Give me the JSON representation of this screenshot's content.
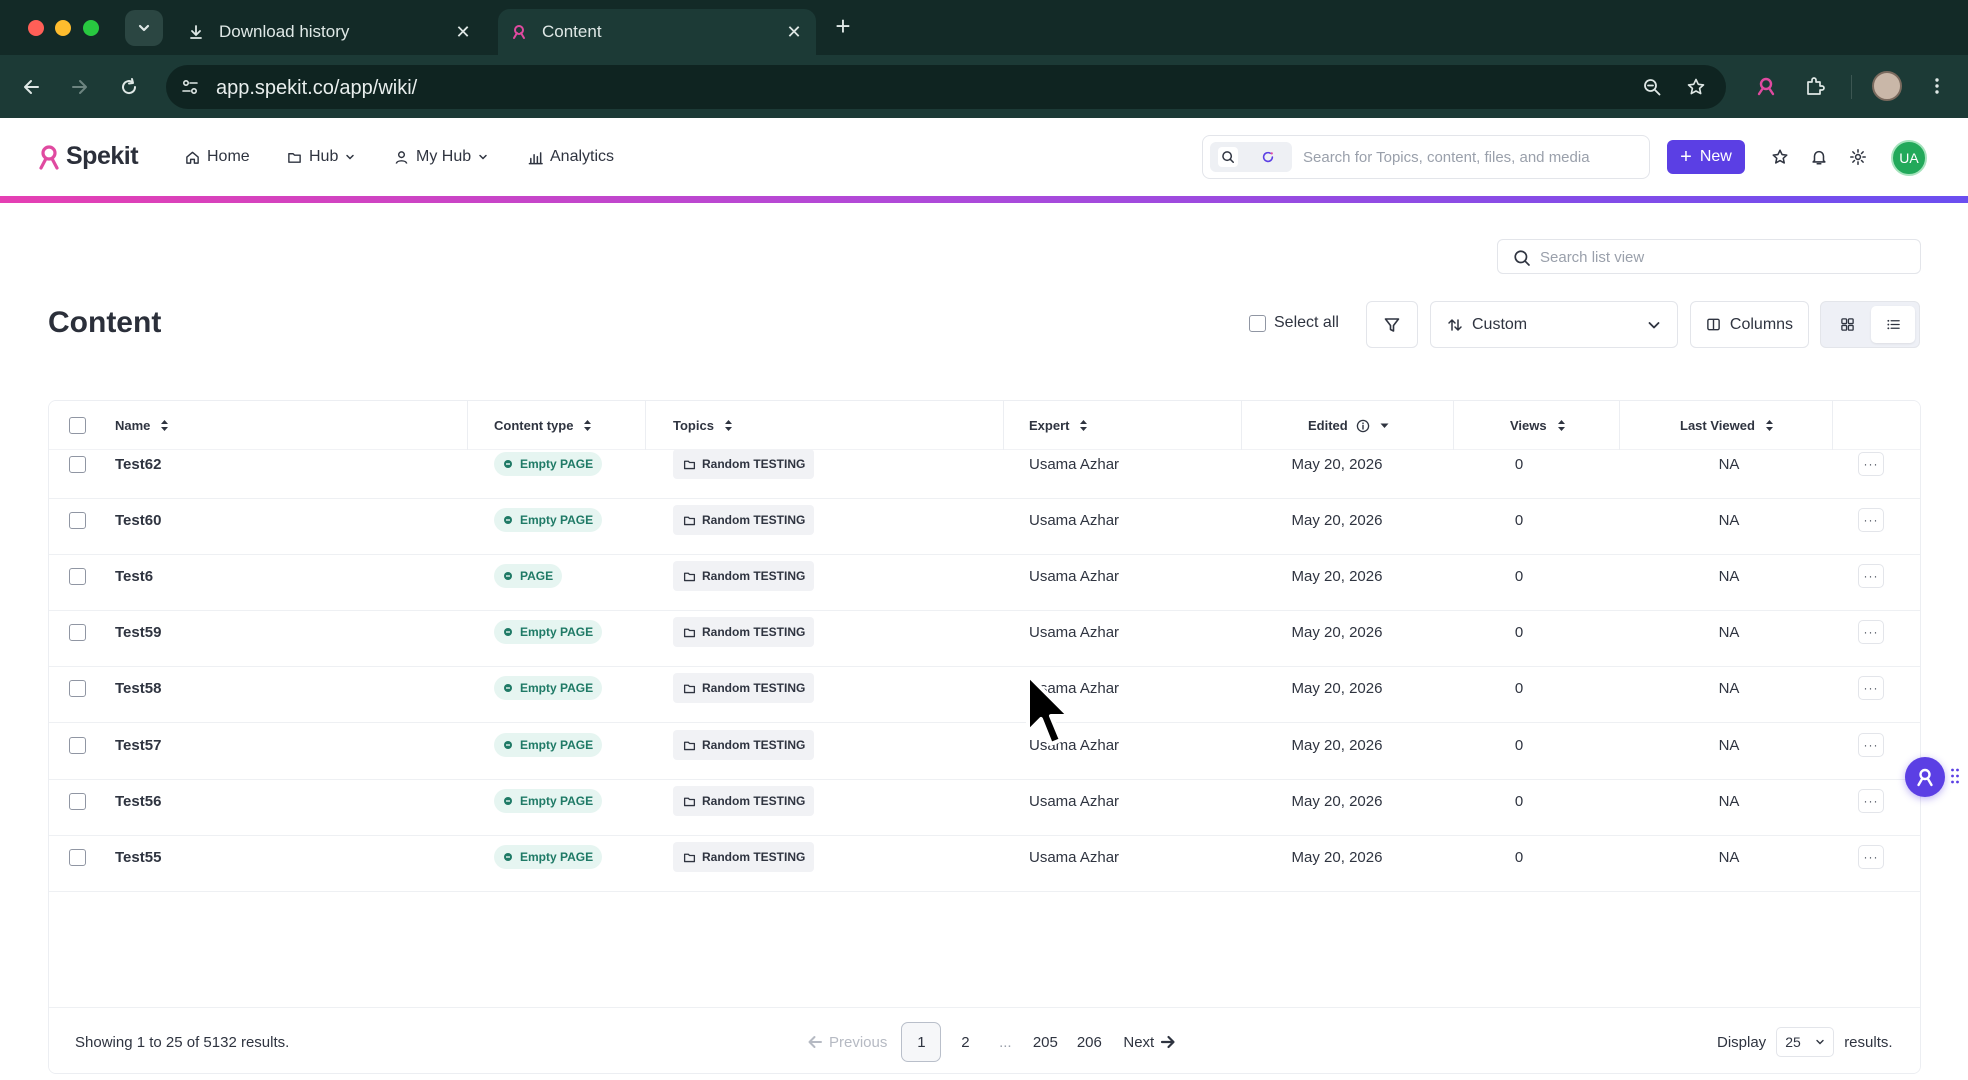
{
  "browser": {
    "tabs": [
      {
        "label": "Download history",
        "icon": "download-icon"
      },
      {
        "label": "Content",
        "icon": "spekit-icon",
        "active": true
      }
    ],
    "url": "app.spekit.co/app/wiki/"
  },
  "app": {
    "brand": "Spekit",
    "nav": [
      {
        "label": "Home",
        "icon": "home-icon"
      },
      {
        "label": "Hub",
        "icon": "folder-icon",
        "dropdown": true
      },
      {
        "label": "My Hub",
        "icon": "user-icon",
        "dropdown": true
      },
      {
        "label": "Analytics",
        "icon": "analytics-icon"
      }
    ],
    "search_placeholder": "Search for Topics, content, files, and media",
    "new_label": "New",
    "user_initials": "UA",
    "accent_color": "#5b3fe4"
  },
  "page": {
    "title": "Content",
    "list_search_placeholder": "Search list view",
    "select_all_label": "Select all",
    "sort_value": "Custom",
    "columns_label": "Columns",
    "view_mode": "list"
  },
  "table": {
    "columns": [
      "Name",
      "Content type",
      "Topics",
      "Expert",
      "Edited",
      "Views",
      "Last Viewed"
    ],
    "rows": [
      {
        "name": "Test62",
        "type": "Empty PAGE",
        "topic": "Random TESTING",
        "expert": "Usama Azhar",
        "edited": "May 20, 2026",
        "views": "0",
        "last_viewed": "NA"
      },
      {
        "name": "Test60",
        "type": "Empty PAGE",
        "topic": "Random TESTING",
        "expert": "Usama Azhar",
        "edited": "May 20, 2026",
        "views": "0",
        "last_viewed": "NA"
      },
      {
        "name": "Test6",
        "type": "PAGE",
        "topic": "Random TESTING",
        "expert": "Usama Azhar",
        "edited": "May 20, 2026",
        "views": "0",
        "last_viewed": "NA"
      },
      {
        "name": "Test59",
        "type": "Empty PAGE",
        "topic": "Random TESTING",
        "expert": "Usama Azhar",
        "edited": "May 20, 2026",
        "views": "0",
        "last_viewed": "NA"
      },
      {
        "name": "Test58",
        "type": "Empty PAGE",
        "topic": "Random TESTING",
        "expert": "Usama Azhar",
        "edited": "May 20, 2026",
        "views": "0",
        "last_viewed": "NA"
      },
      {
        "name": "Test57",
        "type": "Empty PAGE",
        "topic": "Random TESTING",
        "expert": "Usama Azhar",
        "edited": "May 20, 2026",
        "views": "0",
        "last_viewed": "NA"
      },
      {
        "name": "Test56",
        "type": "Empty PAGE",
        "topic": "Random TESTING",
        "expert": "Usama Azhar",
        "edited": "May 20, 2026",
        "views": "0",
        "last_viewed": "NA"
      },
      {
        "name": "Test55",
        "type": "Empty PAGE",
        "topic": "Random TESTING",
        "expert": "Usama Azhar",
        "edited": "May 20, 2026",
        "views": "0",
        "last_viewed": "NA"
      }
    ],
    "more_label": "···"
  },
  "footer": {
    "showing": "Showing 1 to 25 of 5132 results.",
    "previous": "Previous",
    "pages": [
      "1",
      "2",
      "...",
      "205",
      "206"
    ],
    "current_page": "1",
    "next": "Next",
    "display_label": "Display",
    "per_page": "25",
    "results_label": "results."
  }
}
